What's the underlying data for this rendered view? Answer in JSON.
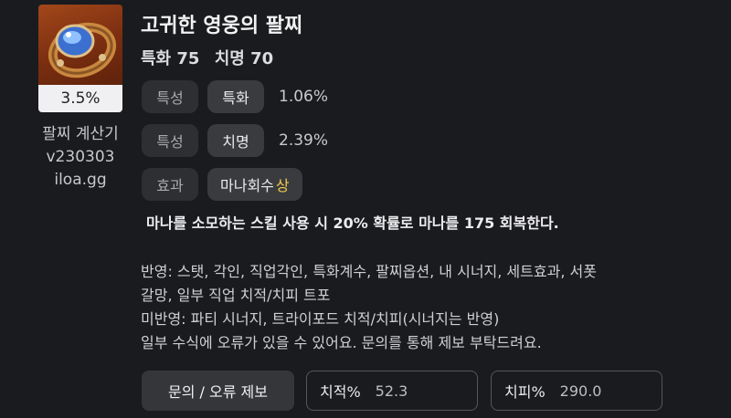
{
  "item": {
    "name": "고귀한 영웅의 팔찌",
    "stats": [
      "특화 75",
      "치명 70"
    ],
    "percent": "3.5%",
    "icon": "bracelet-icon"
  },
  "app": {
    "name": "팔찌 계산기",
    "version": "v230303",
    "site": "iloa.gg"
  },
  "options": [
    {
      "type": "특성",
      "name": "특화",
      "value": "1.06%"
    },
    {
      "type": "특성",
      "name": "치명",
      "value": "2.39%"
    },
    {
      "type": "효과",
      "name": "마나회수",
      "grade": "상"
    }
  ],
  "effect_description": "마나를 소모하는 스킬 사용 시 20% 확률로 마나를 175 회복한다.",
  "notes": [
    "반영: 스탯, 각인, 직업각인, 특화계수, 팔찌옵션, 내 시너지, 세트효과, 서폿",
    "갈망, 일부 직업 치적/치피 트포",
    "미반영: 파티 시너지, 트라이포드 치적/치피(시너지는 반영)",
    "일부 수식에 오류가 있을 수 있어요. 문의를 통해 제보 부탁드려요."
  ],
  "report_button": "문의 / 오류 제보",
  "fields": {
    "crit_rate": {
      "label": "치적%",
      "value": "52.3"
    },
    "crit_damage": {
      "label": "치피%",
      "value": "290.0"
    }
  },
  "colors": {
    "background": "#1a1b1e",
    "grade_high": "#f2c94c"
  }
}
